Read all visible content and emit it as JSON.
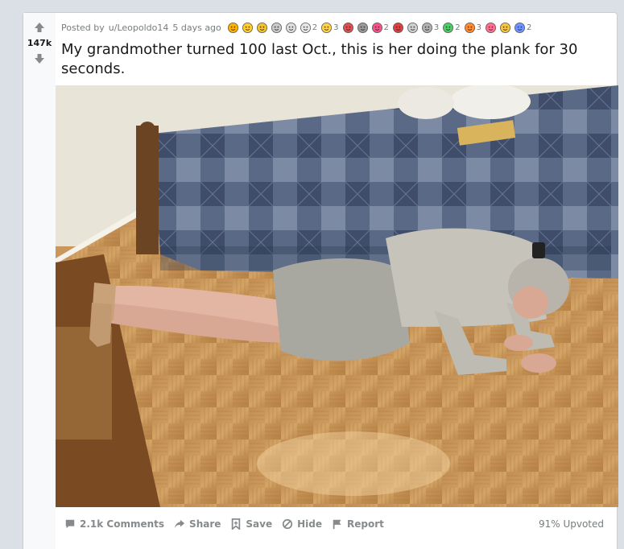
{
  "post": {
    "posted_by_prefix": "Posted by",
    "author": "u/Leopoldo14",
    "time_ago": "5 days ago",
    "score": "147k",
    "title": "My grandmother turned 100 last Oct., this is her doing the plank for 30 seconds.",
    "image_alt": "Elderly woman doing a plank on a parquet floor beside a bed"
  },
  "awards": [
    {
      "icon": "silly-face-award-icon",
      "color": "#ffb000"
    },
    {
      "icon": "wholesome-award-icon",
      "color": "#ffcc33"
    },
    {
      "icon": "clapping-hands-award-icon",
      "color": "#f2c230"
    },
    {
      "icon": "doge-award-icon",
      "color": "#c9c9c9"
    },
    {
      "icon": "bless-up-award-icon",
      "color": "#dddddd"
    },
    {
      "icon": "hugz-award-icon",
      "color": "#e6e6e6",
      "count": "2"
    },
    {
      "icon": "laughing-award-icon",
      "color": "#ffd24d",
      "count": "3"
    },
    {
      "icon": "gift-award-icon",
      "color": "#e84b4b"
    },
    {
      "icon": "cat-award-icon",
      "color": "#999999"
    },
    {
      "icon": "heart-award-icon",
      "color": "#ff4f8b",
      "count": "2"
    },
    {
      "icon": "heart-eyes-award-icon",
      "color": "#e83b3b"
    },
    {
      "icon": "high-five-award-icon",
      "color": "#cfcfcf"
    },
    {
      "icon": "silver-award-icon",
      "color": "#b0b0b0",
      "count": "3"
    },
    {
      "icon": "rocket-award-icon",
      "color": "#46d160",
      "count": "2"
    },
    {
      "icon": "party-award-icon",
      "color": "#ff8c33",
      "count": "3"
    },
    {
      "icon": "love-award-icon",
      "color": "#ff6f8f"
    },
    {
      "icon": "hugs-award-icon",
      "color": "#f4c542"
    },
    {
      "icon": "coin-award-icon",
      "color": "#7193ff",
      "count": "2"
    }
  ],
  "actions": {
    "comments": "2.1k Comments",
    "share": "Share",
    "save": "Save",
    "hide": "Hide",
    "report": "Report",
    "upvoted": "91% Upvoted"
  },
  "colors": {
    "page_bg": "#dae0e6",
    "meta_text": "#787c7e",
    "action_text": "#878a8c"
  }
}
